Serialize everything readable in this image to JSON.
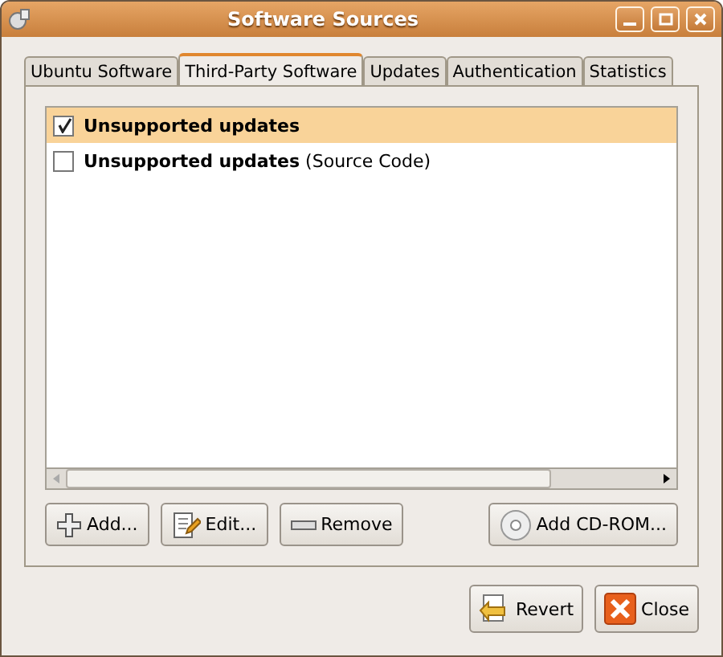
{
  "window": {
    "title": "Software Sources"
  },
  "tabs": [
    {
      "label": "Ubuntu Software",
      "selected": false
    },
    {
      "label": "Third-Party Software",
      "selected": true
    },
    {
      "label": "Updates",
      "selected": false
    },
    {
      "label": "Authentication",
      "selected": false
    },
    {
      "label": "Statistics",
      "selected": false
    }
  ],
  "sources": [
    {
      "name": "Unsupported updates",
      "checked": true,
      "selected": true
    },
    {
      "name": "Unsupported updates",
      "detail": "(Source Code)",
      "checked": false,
      "selected": false
    }
  ],
  "list_buttons": [
    {
      "kind": "add",
      "label": "Add..."
    },
    {
      "kind": "edit",
      "label": "Edit..."
    },
    {
      "kind": "remove",
      "label": "Remove"
    },
    {
      "kind": "cdrom",
      "label": "Add CD-ROM..."
    }
  ],
  "dialog_buttons": [
    {
      "kind": "revert",
      "label": "Revert"
    },
    {
      "kind": "close",
      "label": "Close"
    }
  ]
}
